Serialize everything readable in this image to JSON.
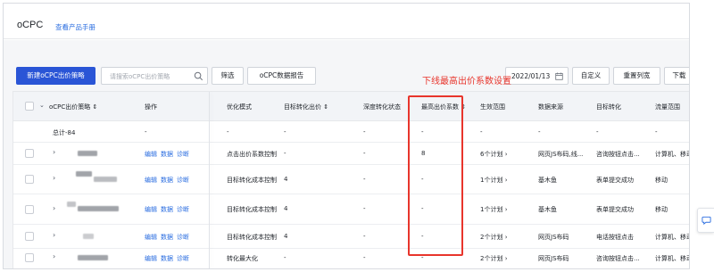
{
  "header": {
    "title": "oCPC",
    "manual_link": "查看产品手册"
  },
  "toolbar": {
    "new_button": "新建oCPC出价策略",
    "search_placeholder": "请搜索oCPC出价策略",
    "filter_button": "筛选",
    "report_button": "oCPC数据报告",
    "date": "2022/01/13",
    "custom_button": "自定义",
    "reset_button": "重置列宽",
    "download_button": "下载"
  },
  "annotation": "下线最高出价系数设置",
  "table": {
    "columns": {
      "strategy": "oCPC出价策略",
      "actions": "操作",
      "mode": "优化模式",
      "target_bid": "目标转化出价",
      "deep_status": "深度转化状态",
      "max_coef": "最高出价系数",
      "scope": "生效范围",
      "source": "数据来源",
      "target_conv": "目标转化",
      "traffic": "流量范围"
    },
    "sort_marker": "⇕",
    "total": {
      "label": "总计-84",
      "actions": "-",
      "mode": "-",
      "target_bid": "-",
      "deep_status": "-",
      "max_coef": "-",
      "scope": "-",
      "source": "-",
      "target_conv": "-",
      "traffic": "-"
    },
    "rows": [
      {
        "a1": "编辑",
        "a2": "数据",
        "a3": "诊断",
        "mode": "点击出价系数控制",
        "target_bid": "-",
        "deep_status": "-",
        "max_coef": "8",
        "scope": "6个计划",
        "source": "网页JS布码,线...",
        "target_conv": "咨询按钮点击...",
        "traffic": "计算机、移动"
      },
      {
        "a1": "编辑",
        "a2": "数据",
        "a3": "诊断",
        "mode": "目标转化成本控制",
        "target_bid": "4",
        "deep_status": "-",
        "max_coef": "-",
        "scope": "1个计划",
        "source": "基木鱼",
        "target_conv": "表单提交成功",
        "traffic": "移动"
      },
      {
        "a1": "编辑",
        "a2": "数据",
        "a3": "诊断",
        "mode": "目标转化成本控制",
        "target_bid": "4",
        "deep_status": "-",
        "max_coef": "-",
        "scope": "1个计划",
        "source": "基木鱼",
        "target_conv": "表单提交成功",
        "traffic": "移动"
      },
      {
        "a1": "编辑",
        "a2": "数据",
        "a3": "诊断",
        "mode": "目标转化成本控制",
        "target_bid": "4",
        "deep_status": "-",
        "max_coef": "-",
        "scope": "2个计划",
        "source": "网页JS布码",
        "target_conv": "电话按钮点击",
        "traffic": "计算机、移动"
      },
      {
        "a1": "编辑",
        "a2": "数据",
        "a3": "诊断",
        "mode": "转化最大化",
        "target_bid": "-",
        "deep_status": "-",
        "max_coef": "-",
        "scope": "2个计划",
        "source": "网页JS布码",
        "target_conv": "咨询按钮点击...",
        "traffic": "计算机、移动"
      }
    ]
  },
  "colors": {
    "primary": "#2a55d6",
    "link": "#2a6de0",
    "annotation": "#e8352c"
  },
  "icons": {
    "search": "search-icon",
    "calendar": "calendar-icon",
    "expand": "chevron-right-icon",
    "feedback": "chat-icon"
  }
}
